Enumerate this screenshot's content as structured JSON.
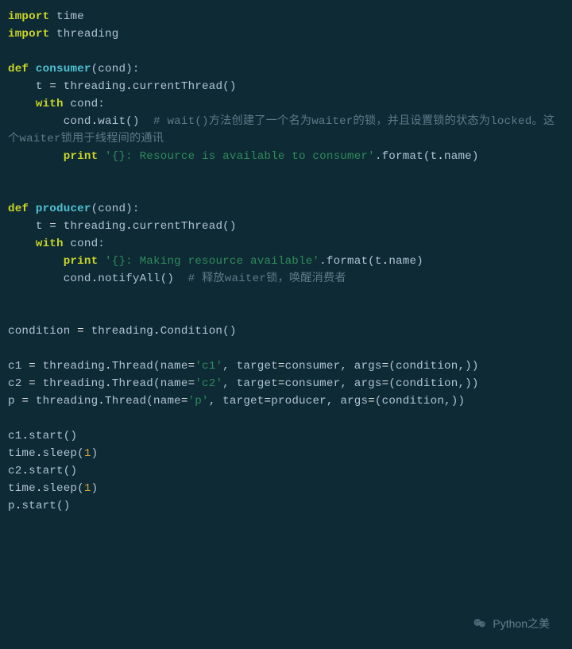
{
  "code": {
    "l1": {
      "kw": "import",
      "mod": "time"
    },
    "l2": {
      "kw": "import",
      "mod": "threading"
    },
    "l4": {
      "kw": "def",
      "fn": "consumer",
      "params": "(cond):"
    },
    "l5": {
      "a": "    t ",
      "eq": "=",
      "b": " threading",
      "dot": ".",
      "c": "currentThread()"
    },
    "l6": {
      "kw": "    with",
      "a": " cond:",
      "_": ""
    },
    "l6b": {
      "pre": "    ",
      "kw": "with",
      "a": " cond:"
    },
    "l7": {
      "a": "        cond",
      "dot": ".",
      "b": "wait()  ",
      "cmt": "# wait()方法创建了一个名为waiter的锁，并且设置锁的状态为locked。这个waiter锁用于线程间的通讯"
    },
    "l8": {
      "pre": "        ",
      "kw": "print",
      "sp": " ",
      "s": "'{}: Resource is available to consumer'",
      "a": ".format(t",
      "dot": ".",
      "b": "name)"
    },
    "l11": {
      "kw": "def",
      "fn": "producer",
      "params": "(cond):"
    },
    "l12": {
      "a": "    t ",
      "eq": "=",
      "b": " threading",
      "dot": ".",
      "c": "currentThread()"
    },
    "l13": {
      "pre": "    ",
      "kw": "with",
      "a": " cond:"
    },
    "l14": {
      "pre": "        ",
      "kw": "print",
      "sp": " ",
      "s": "'{}: Making resource available'",
      "a": ".format(t",
      "dot": ".",
      "b": "name)"
    },
    "l15": {
      "a": "        cond",
      "dot": ".",
      "b": "notifyAll()  ",
      "cmt": "# 释放waiter锁，唤醒消费者"
    },
    "l18": {
      "a": "condition ",
      "eq": "=",
      "b": " threading",
      "dot": ".",
      "c": "Condition()"
    },
    "l20": {
      "a": "c1 ",
      "eq": "=",
      "b": " threading",
      "dot": ".",
      "c": "Thread(name",
      "eq2": "=",
      "s": "'c1'",
      "d": ", target",
      "eq3": "=",
      "e": "consumer, args",
      "eq4": "=",
      "f": "(condition,))"
    },
    "l21": {
      "a": "c2 ",
      "eq": "=",
      "b": " threading",
      "dot": ".",
      "c": "Thread(name",
      "eq2": "=",
      "s": "'c2'",
      "d": ", target",
      "eq3": "=",
      "e": "consumer, args",
      "eq4": "=",
      "f": "(condition,))"
    },
    "l22": {
      "a": "p ",
      "eq": "=",
      "b": " threading",
      "dot": ".",
      "c": "Thread(name",
      "eq2": "=",
      "s": "'p'",
      "d": ", target",
      "eq3": "=",
      "e": "producer, args",
      "eq4": "=",
      "f": "(condition,))"
    },
    "l24": {
      "a": "c1",
      "dot": ".",
      "b": "start()"
    },
    "l25": {
      "a": "time",
      "dot": ".",
      "b": "sleep(",
      "n": "1",
      "c": ")"
    },
    "l26": {
      "a": "c2",
      "dot": ".",
      "b": "start()"
    },
    "l27": {
      "a": "time",
      "dot": ".",
      "b": "sleep(",
      "n": "1",
      "c": ")"
    },
    "l28": {
      "a": "p",
      "dot": ".",
      "b": "start()"
    }
  },
  "watermark": "Python之美"
}
